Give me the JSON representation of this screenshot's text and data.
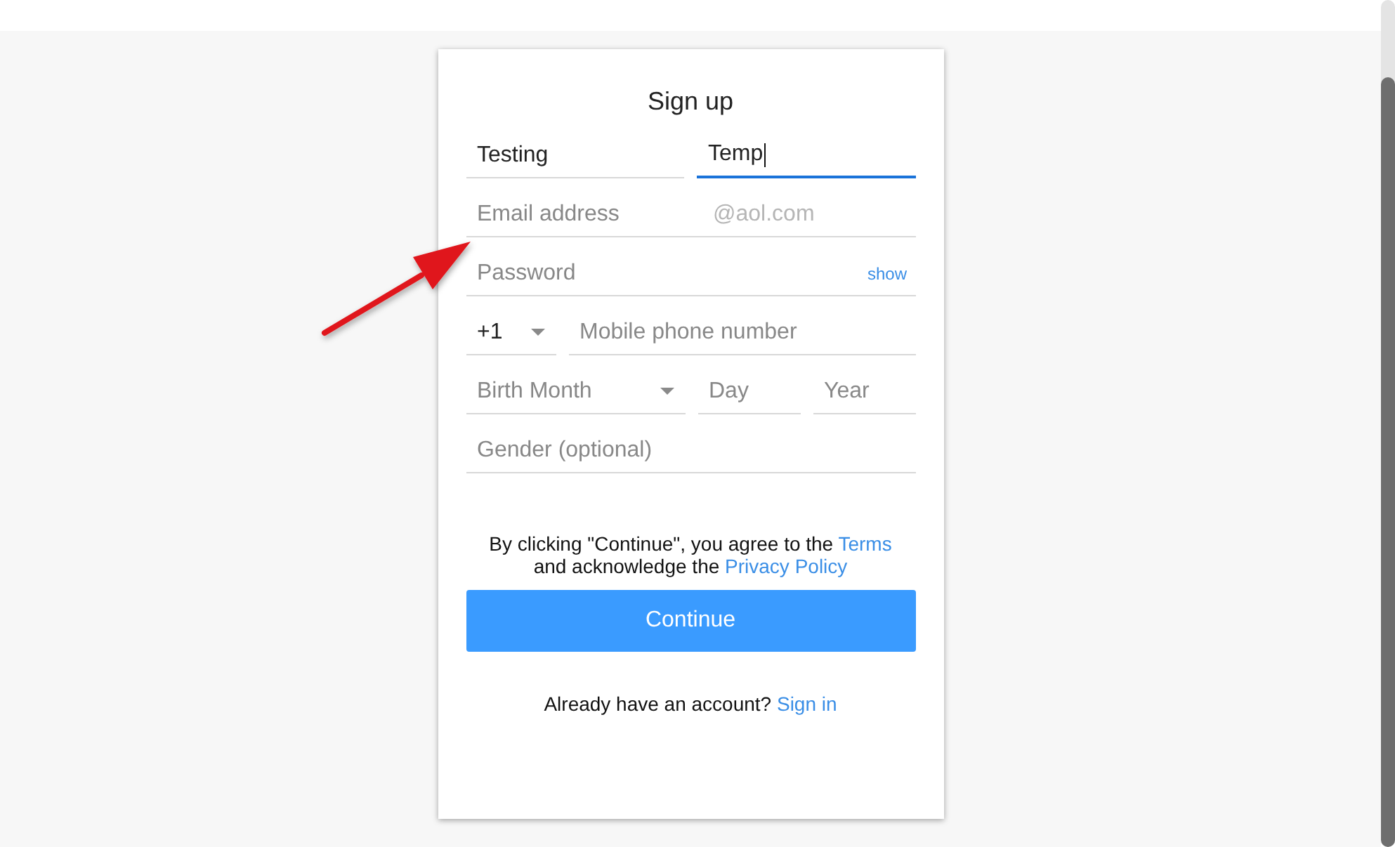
{
  "form": {
    "title": "Sign up"
  },
  "name_fields": [
    {
      "value": "Testing",
      "focused": false
    },
    {
      "value": "Temp",
      "focused": true
    }
  ],
  "email": {
    "placeholder": "Email address",
    "suffix": "@aol.com"
  },
  "password": {
    "placeholder": "Password",
    "toggle": "show"
  },
  "phone": {
    "country_code": "+1",
    "placeholder": "Mobile phone number"
  },
  "birth_date": {
    "month_placeholder": "Birth Month",
    "day_placeholder": "Day",
    "year_placeholder": "Year"
  },
  "gender": {
    "placeholder": "Gender (optional)"
  },
  "terms": {
    "before_terms": "By clicking \"Continue\", you agree to the",
    "terms_link": "Terms",
    "middle": "and acknowledge the",
    "privacy_link": "Privacy Policy"
  },
  "continue_button": "Continue",
  "sign_in": {
    "text": "Already have an account?",
    "link": "Sign in"
  }
}
